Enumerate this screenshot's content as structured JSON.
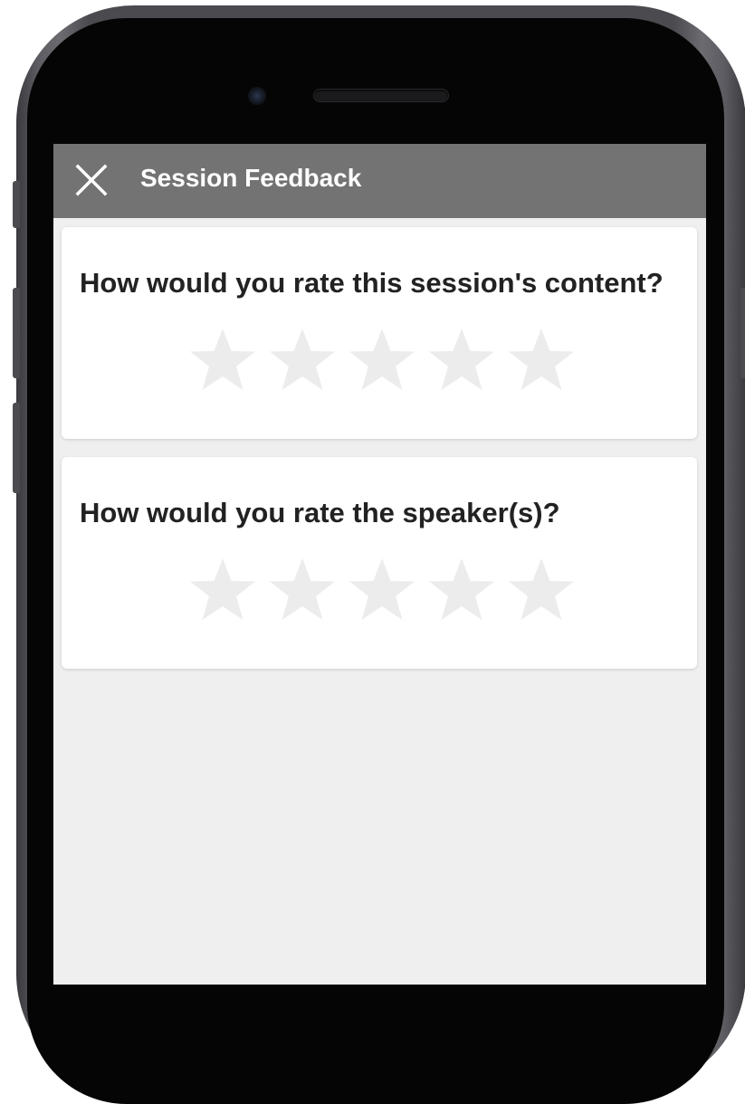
{
  "header": {
    "title": "Session Feedback",
    "close_icon": "close-icon"
  },
  "questions": [
    {
      "text": "How would you rate this session's content?",
      "rating": 0,
      "max_rating": 5
    },
    {
      "text": "How would you rate the speaker(s)?",
      "rating": 0,
      "max_rating": 5
    }
  ],
  "colors": {
    "header_bg": "#737373",
    "screen_bg": "#efefef",
    "star_empty": "#ececec",
    "question_text": "#222222"
  }
}
